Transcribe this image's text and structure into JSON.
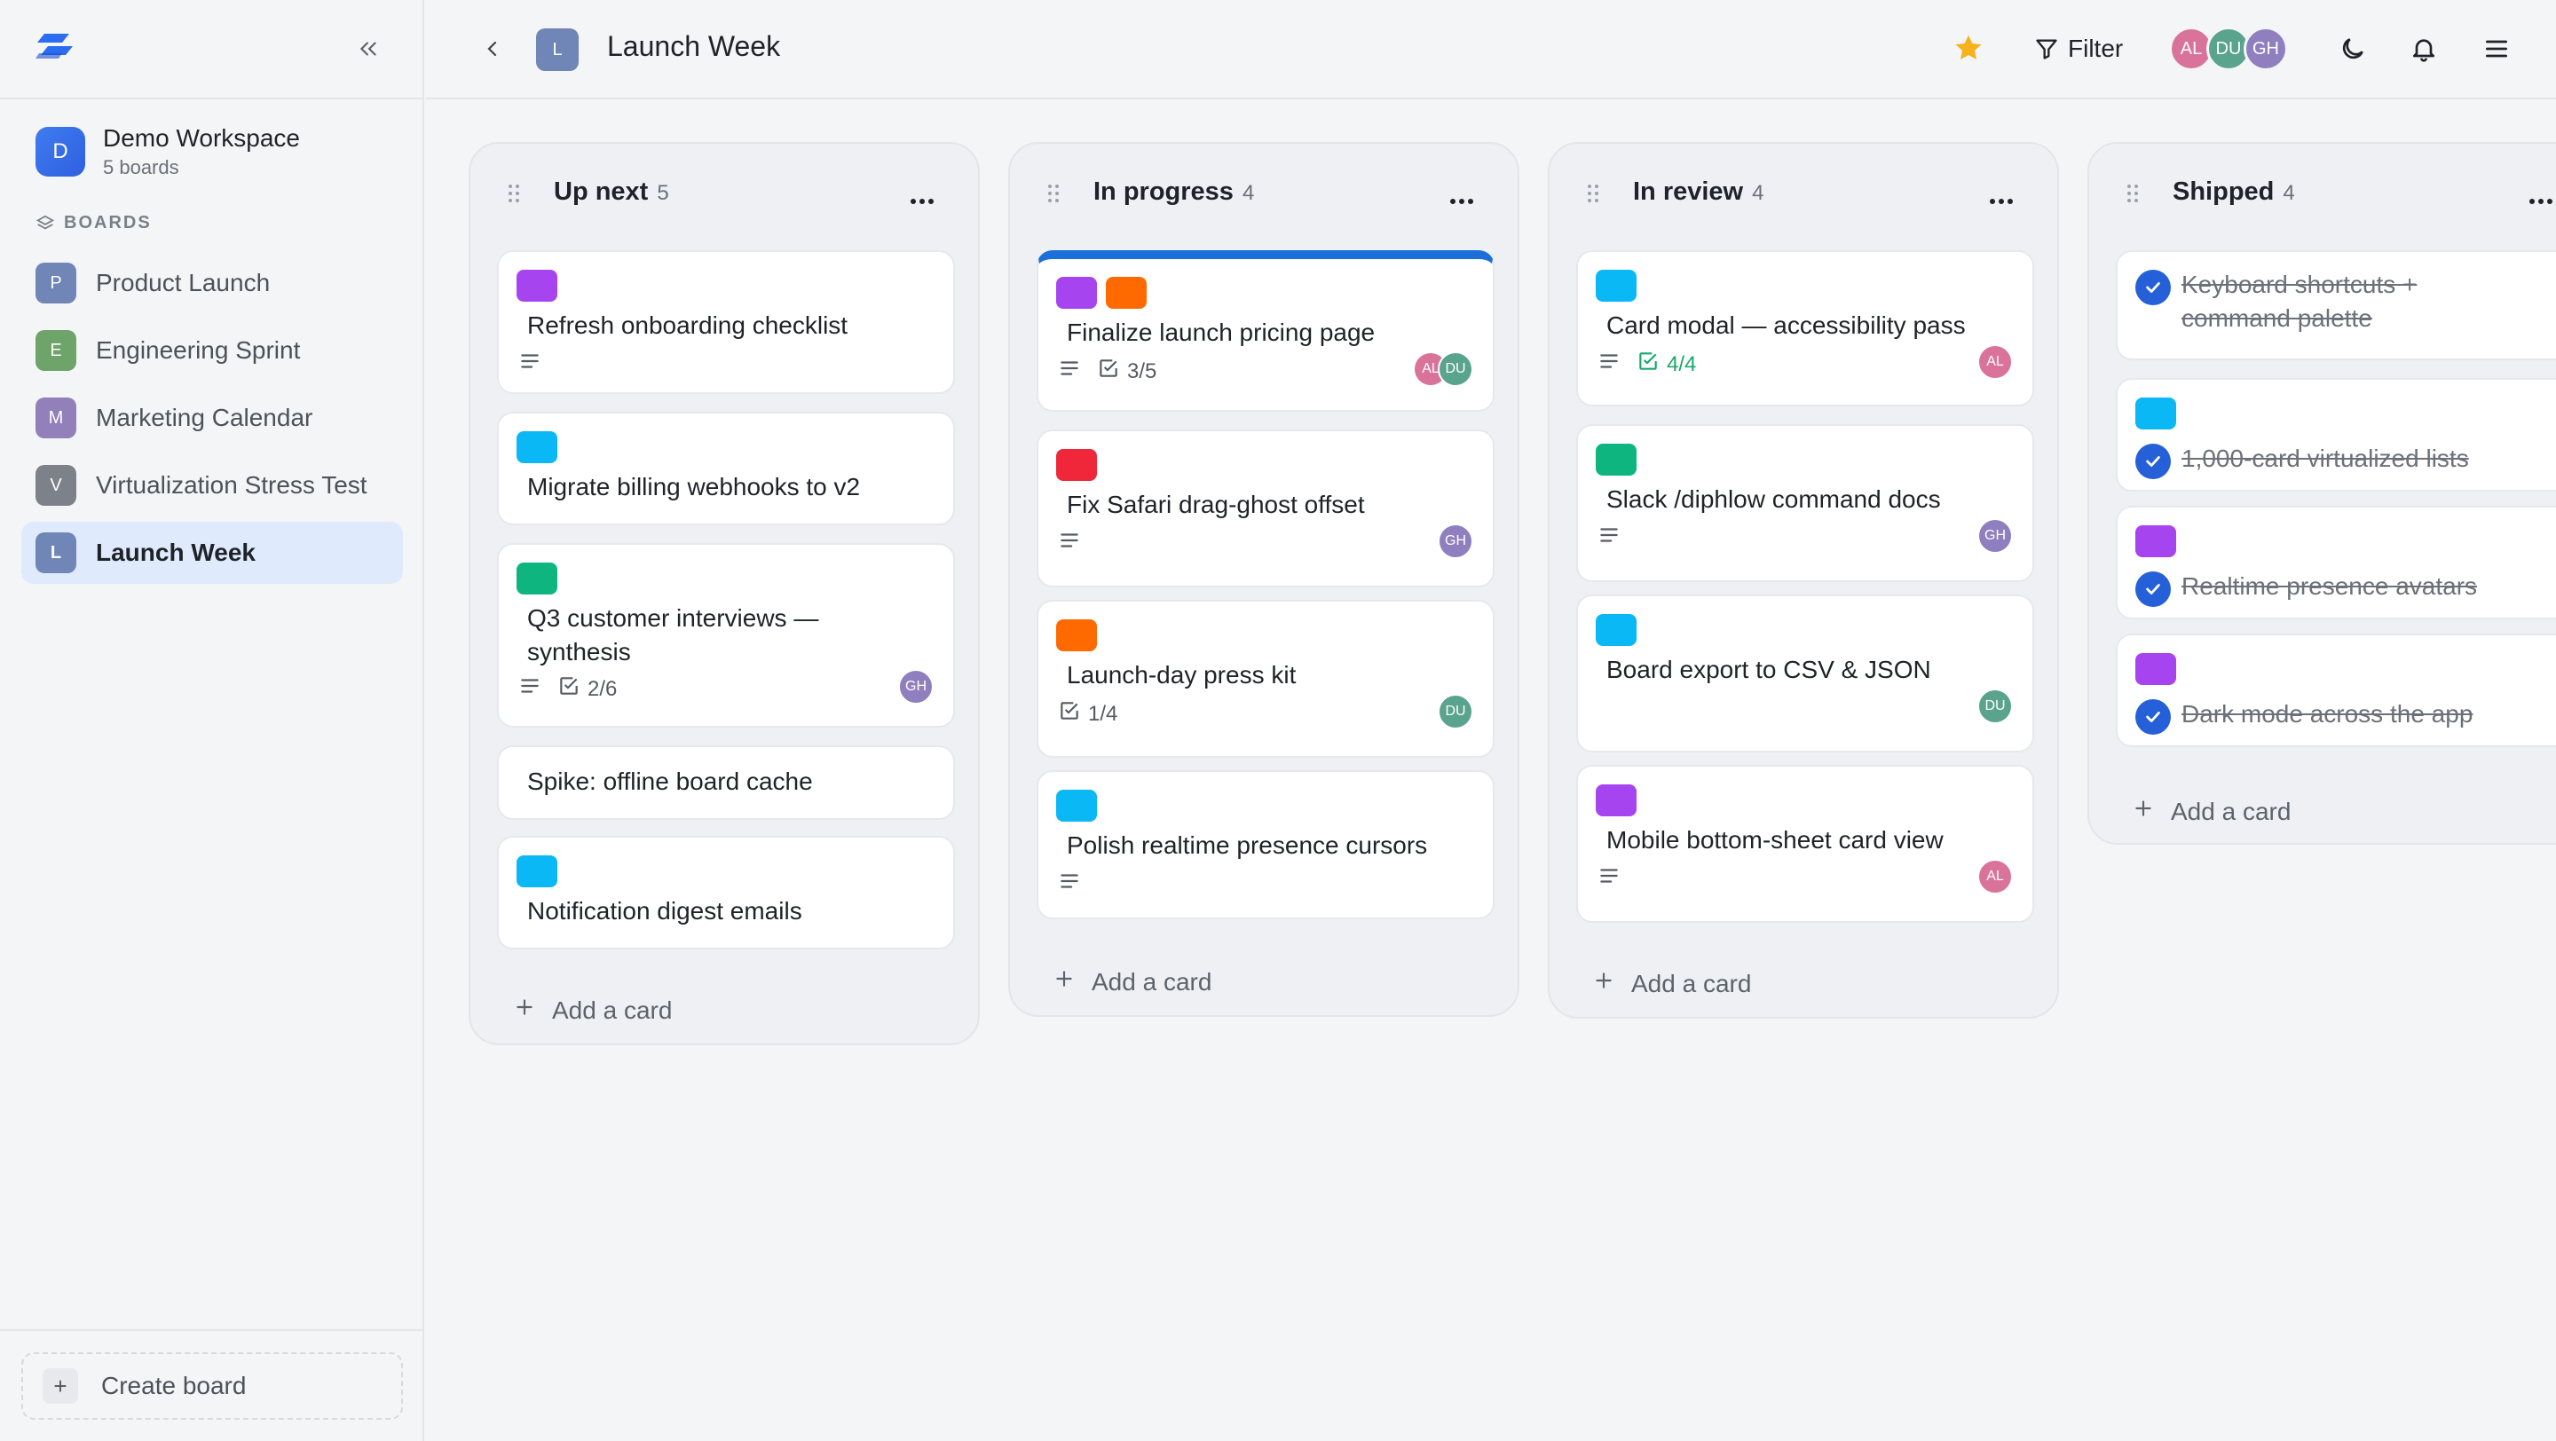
{
  "sidebar": {
    "workspace": {
      "initial": "D",
      "name": "Demo Workspace",
      "sub": "5 boards"
    },
    "boards_header": "BOARDS",
    "boards": [
      {
        "initial": "P",
        "label": "Product Launch",
        "color": "#6f86b7"
      },
      {
        "initial": "E",
        "label": "Engineering Sprint",
        "color": "#6ea36a"
      },
      {
        "initial": "M",
        "label": "Marketing Calendar",
        "color": "#9180ba"
      },
      {
        "initial": "V",
        "label": "Virtualization Stress Test",
        "color": "#7d828a"
      },
      {
        "initial": "L",
        "label": "Launch Week",
        "color": "#6f86b7",
        "active": true
      }
    ],
    "create_board": "Create board"
  },
  "topbar": {
    "board_initial": "L",
    "board_title": "Launch Week",
    "filter_label": "Filter",
    "presence": [
      {
        "initials": "AL",
        "color": "#d9739a"
      },
      {
        "initials": "DU",
        "color": "#5aa38c"
      },
      {
        "initials": "GH",
        "color": "#8f7fbf"
      }
    ]
  },
  "colors": {
    "purple": "#a645f0",
    "cyan": "#0ab8f5",
    "green": "#0fb57f",
    "red": "#f0273a",
    "orange": "#ff6a00",
    "accent": "#1a6fd8"
  },
  "lanes": [
    {
      "title": "Up next",
      "count": "5",
      "add": "Add a card",
      "cards": [
        {
          "labels": [
            "purple"
          ],
          "title": "Refresh onboarding checklist",
          "desc": true
        },
        {
          "labels": [
            "cyan"
          ],
          "title": "Migrate billing webhooks to v2"
        },
        {
          "labels": [
            "green"
          ],
          "title": "Q3 customer interviews —",
          "title2": "synthesis",
          "desc": true,
          "checklist": "2/6",
          "avatars": [
            "GH"
          ]
        },
        {
          "labels": [],
          "title": "Spike: offline board cache"
        },
        {
          "labels": [
            "cyan"
          ],
          "title": "Notification digest emails"
        }
      ]
    },
    {
      "title": "In progress",
      "count": "4",
      "add": "Add a card",
      "cards": [
        {
          "labels": [
            "purple",
            "orange"
          ],
          "title": "Finalize launch pricing page",
          "desc": true,
          "checklist": "3/5",
          "avatars": [
            "AL",
            "DU"
          ]
        },
        {
          "labels": [
            "red"
          ],
          "title": "Fix Safari drag-ghost offset",
          "desc": true,
          "avatars": [
            "GH"
          ]
        },
        {
          "labels": [
            "orange"
          ],
          "title": "Launch-day press kit",
          "checklist": "1/4",
          "avatars": [
            "DU"
          ]
        },
        {
          "labels": [
            "cyan"
          ],
          "title": "Polish realtime presence cursors",
          "desc": true
        }
      ]
    },
    {
      "title": "In review",
      "count": "4",
      "add": "Add a card",
      "cards": [
        {
          "labels": [
            "cyan"
          ],
          "title": "Card modal — accessibility pass",
          "desc": true,
          "checklist": "4/4",
          "avatars": [
            "AL"
          ]
        },
        {
          "labels": [
            "green"
          ],
          "title": "Slack /diphlow command docs",
          "desc": true,
          "avatars": [
            "GH"
          ]
        },
        {
          "labels": [
            "cyan"
          ],
          "title": "Board export to CSV & JSON",
          "avatars": [
            "DU"
          ]
        },
        {
          "labels": [
            "purple"
          ],
          "title": "Mobile bottom-sheet card view",
          "desc": true,
          "avatars": [
            "AL"
          ]
        }
      ]
    },
    {
      "title": "Shipped",
      "count": "4",
      "add": "Add a card",
      "cards": [
        {
          "labels": [],
          "title": "Keyboard shortcuts +",
          "title2": "command palette"
        },
        {
          "labels": [
            "cyan"
          ],
          "title": "1,000-card virtualized lists"
        },
        {
          "labels": [
            "purple"
          ],
          "title": "Realtime presence avatars"
        },
        {
          "labels": [
            "purple"
          ],
          "title": "Dark mode across the app"
        }
      ]
    }
  ]
}
